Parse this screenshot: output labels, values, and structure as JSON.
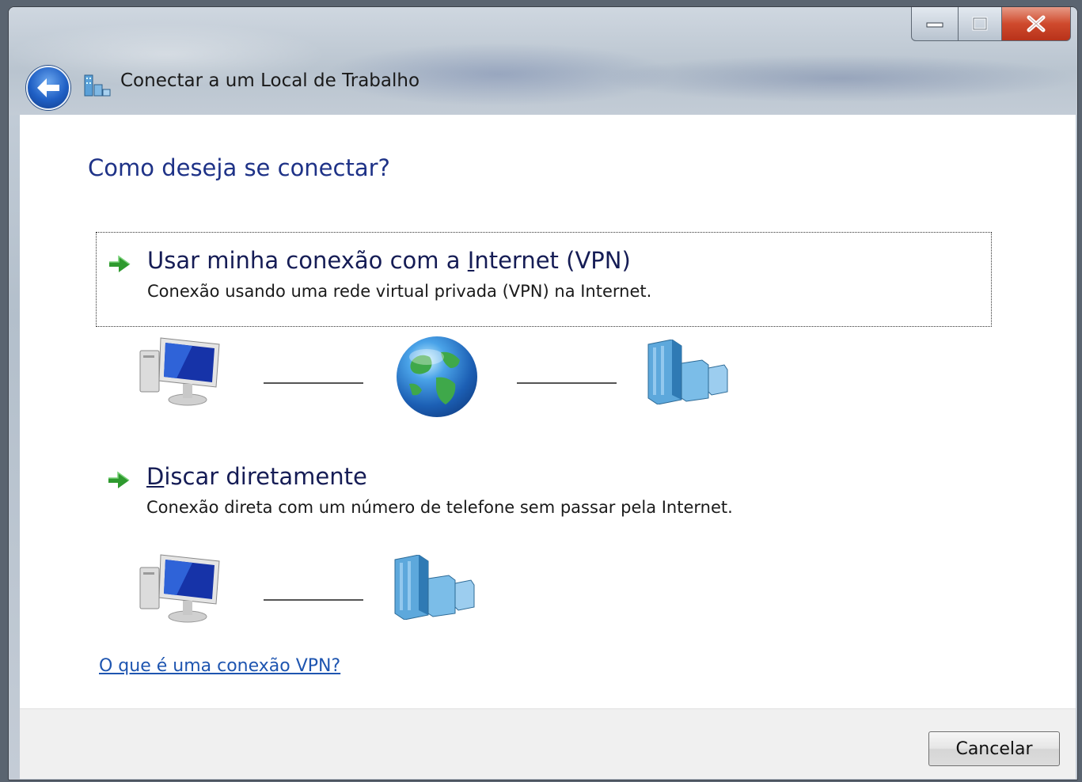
{
  "window": {
    "title": "Conectar a um Local de Trabalho"
  },
  "heading": "Como deseja se conectar?",
  "options": [
    {
      "title_before": "Usar minha conexão com a ",
      "title_mnemonic": "I",
      "title_after": "nternet (VPN)",
      "description": "Conexão usando uma rede virtual privada (VPN) na Internet.",
      "diagram": [
        "computer-icon",
        "globe-icon",
        "building-icon"
      ]
    },
    {
      "title_before": "",
      "title_mnemonic": "D",
      "title_after": "iscar diretamente",
      "description": "Conexão direta com um número de telefone sem passar pela Internet.",
      "diagram": [
        "computer-icon",
        "building-icon"
      ]
    }
  ],
  "help_link": "O que é uma conexão VPN?",
  "footer": {
    "cancel_label": "Cancelar"
  }
}
